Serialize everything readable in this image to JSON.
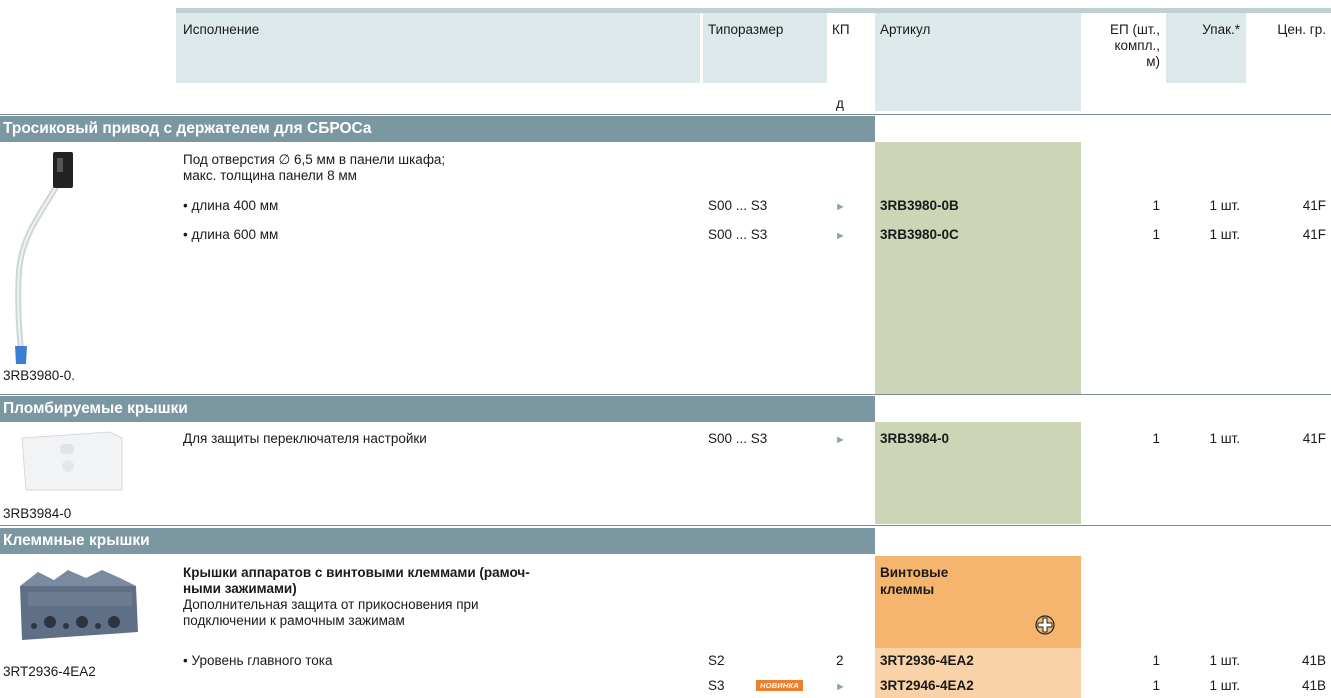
{
  "header": {
    "execution": "Исполнение",
    "size": "Типоразмер",
    "kp": "КП",
    "kp_sub": "д",
    "article": "Артикул",
    "ep_line1": "ЕП (шт.,",
    "ep_line2": "компл.,",
    "ep_line3": "м)",
    "pack": "Упак.*",
    "price_group": "Цен. гр."
  },
  "sections": [
    {
      "title": "Тросиковый привод с держателем для СБРОСа",
      "image_caption": "3RB3980-0.",
      "description_line1": "Под отверстия ∅ 6,5 мм в панели шкафа;",
      "description_line2": "макс. толщина панели 8 мм",
      "rows": [
        {
          "desc": "• длина 400 мм",
          "size": "S00 ... S3",
          "kp": "►",
          "article": "3RB3980-0B",
          "ep": "1",
          "pack": "1 шт.",
          "pg": "41F"
        },
        {
          "desc": "• длина 600 мм",
          "size": "S00 ... S3",
          "kp": "►",
          "article": "3RB3980-0C",
          "ep": "1",
          "pack": "1 шт.",
          "pg": "41F"
        }
      ]
    },
    {
      "title": "Пломбируемые крышки",
      "image_caption": "3RB3984-0",
      "rows": [
        {
          "desc": "Для защиты переключателя настройки",
          "size": "S00 ... S3",
          "kp": "►",
          "article": "3RB3984-0",
          "ep": "1",
          "pack": "1 шт.",
          "pg": "41F"
        }
      ]
    },
    {
      "title": "Клеммные крышки",
      "image_caption": "3RT2936-4EA2",
      "heading_line1": "Крышки аппаратов с винтовыми клеммами (рамоч-",
      "heading_line2": "ными зажимами)",
      "description_line1": "Дополнительная защита от прикосновения при",
      "description_line2": "подключении к рамочным зажимам",
      "terminal_label_line1": "Винтовые",
      "terminal_label_line2": "клеммы",
      "badge": "НОВИНКА",
      "rows": [
        {
          "desc": "• Уровень главного тока",
          "size": "S2",
          "kp": "2",
          "article": "3RT2936-4EA2",
          "ep": "1",
          "pack": "1 шт.",
          "pg": "41B"
        },
        {
          "desc": "",
          "size": "S3",
          "kp": "►",
          "article": "3RT2946-4EA2",
          "ep": "1",
          "pack": "1 шт.",
          "pg": "41B"
        }
      ]
    }
  ],
  "colors": {
    "header_bg": "#dde8ea",
    "section_bar": "#7b97a2",
    "article_green": "#ccd5b6",
    "article_orange": "#f5b56e",
    "article_orange_light": "#f9d2a7",
    "badge_orange": "#ee7f2d"
  }
}
